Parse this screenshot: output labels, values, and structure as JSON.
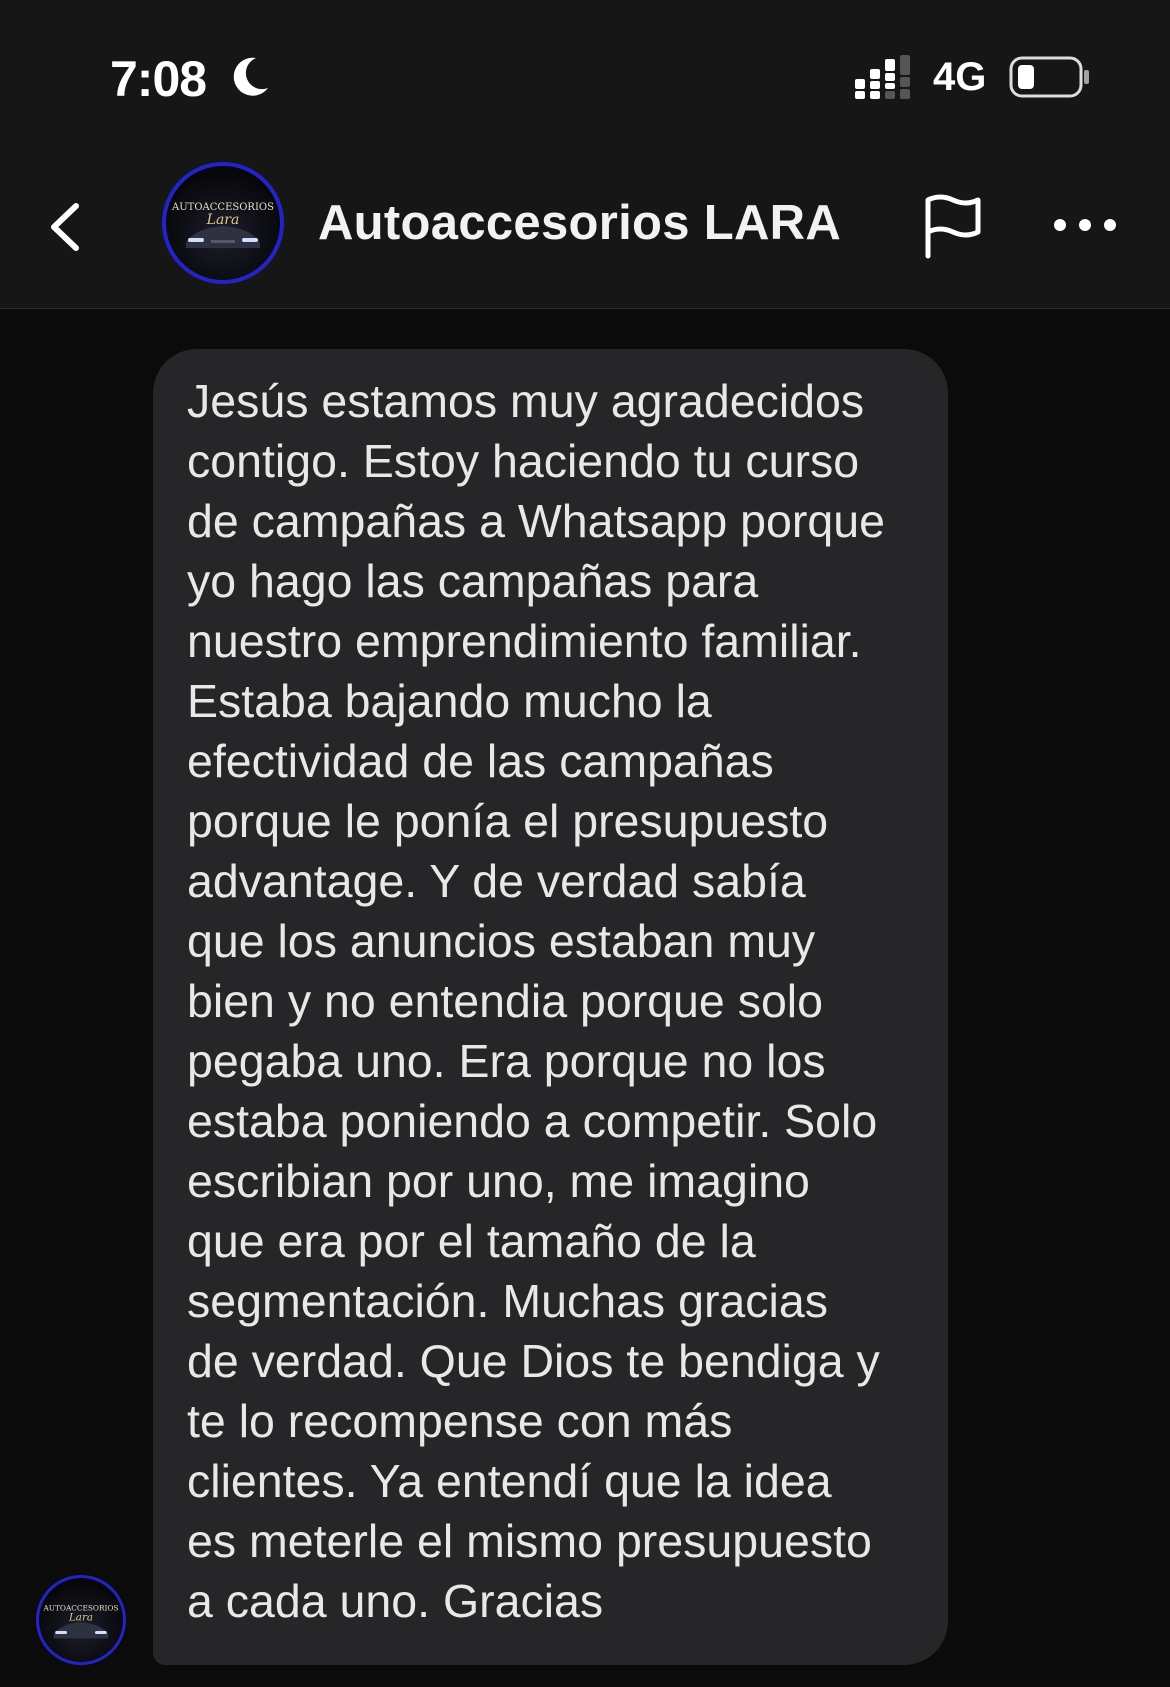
{
  "status_bar": {
    "time": "7:08",
    "network": "4G"
  },
  "header": {
    "contact_name": "Autoaccesorios LARA",
    "avatar_logo_text": "AUTOACCESORIOS Lara"
  },
  "message": {
    "text": "Jesús estamos muy agradecidos\ncontigo. Estoy haciendo tu curso\nde campañas a Whatsapp porque\nyo hago las campañas para\nnuestro emprendimiento familiar.\nEstaba bajando mucho la\nefectividad de las campañas\nporque le ponía el presupuesto\nadvantage. Y de verdad sabía\nque los anuncios estaban muy\nbien y no entendia porque solo\npegaba uno. Era porque no los\nestaba poniendo a competir. Solo\nescribian por uno, me imagino\nque era por el tamaño de la\nsegmentación. Muchas gracias\nde verdad. Que Dios te bendiga y\nte lo recompense con más\nclientes. Ya entendí que la idea\nes meterle el mismo presupuesto\na cada uno. Gracias"
  },
  "colors": {
    "background": "#0b0b0c",
    "header_bg": "#161617",
    "bubble_bg": "#262628",
    "avatar_ring": "#2323c8"
  },
  "icons": {
    "do_not_disturb": "moon-icon",
    "signal": "signal-icon",
    "battery": "battery-icon",
    "back": "chevron-left-icon",
    "report": "flag-icon",
    "more": "ellipsis-icon"
  }
}
